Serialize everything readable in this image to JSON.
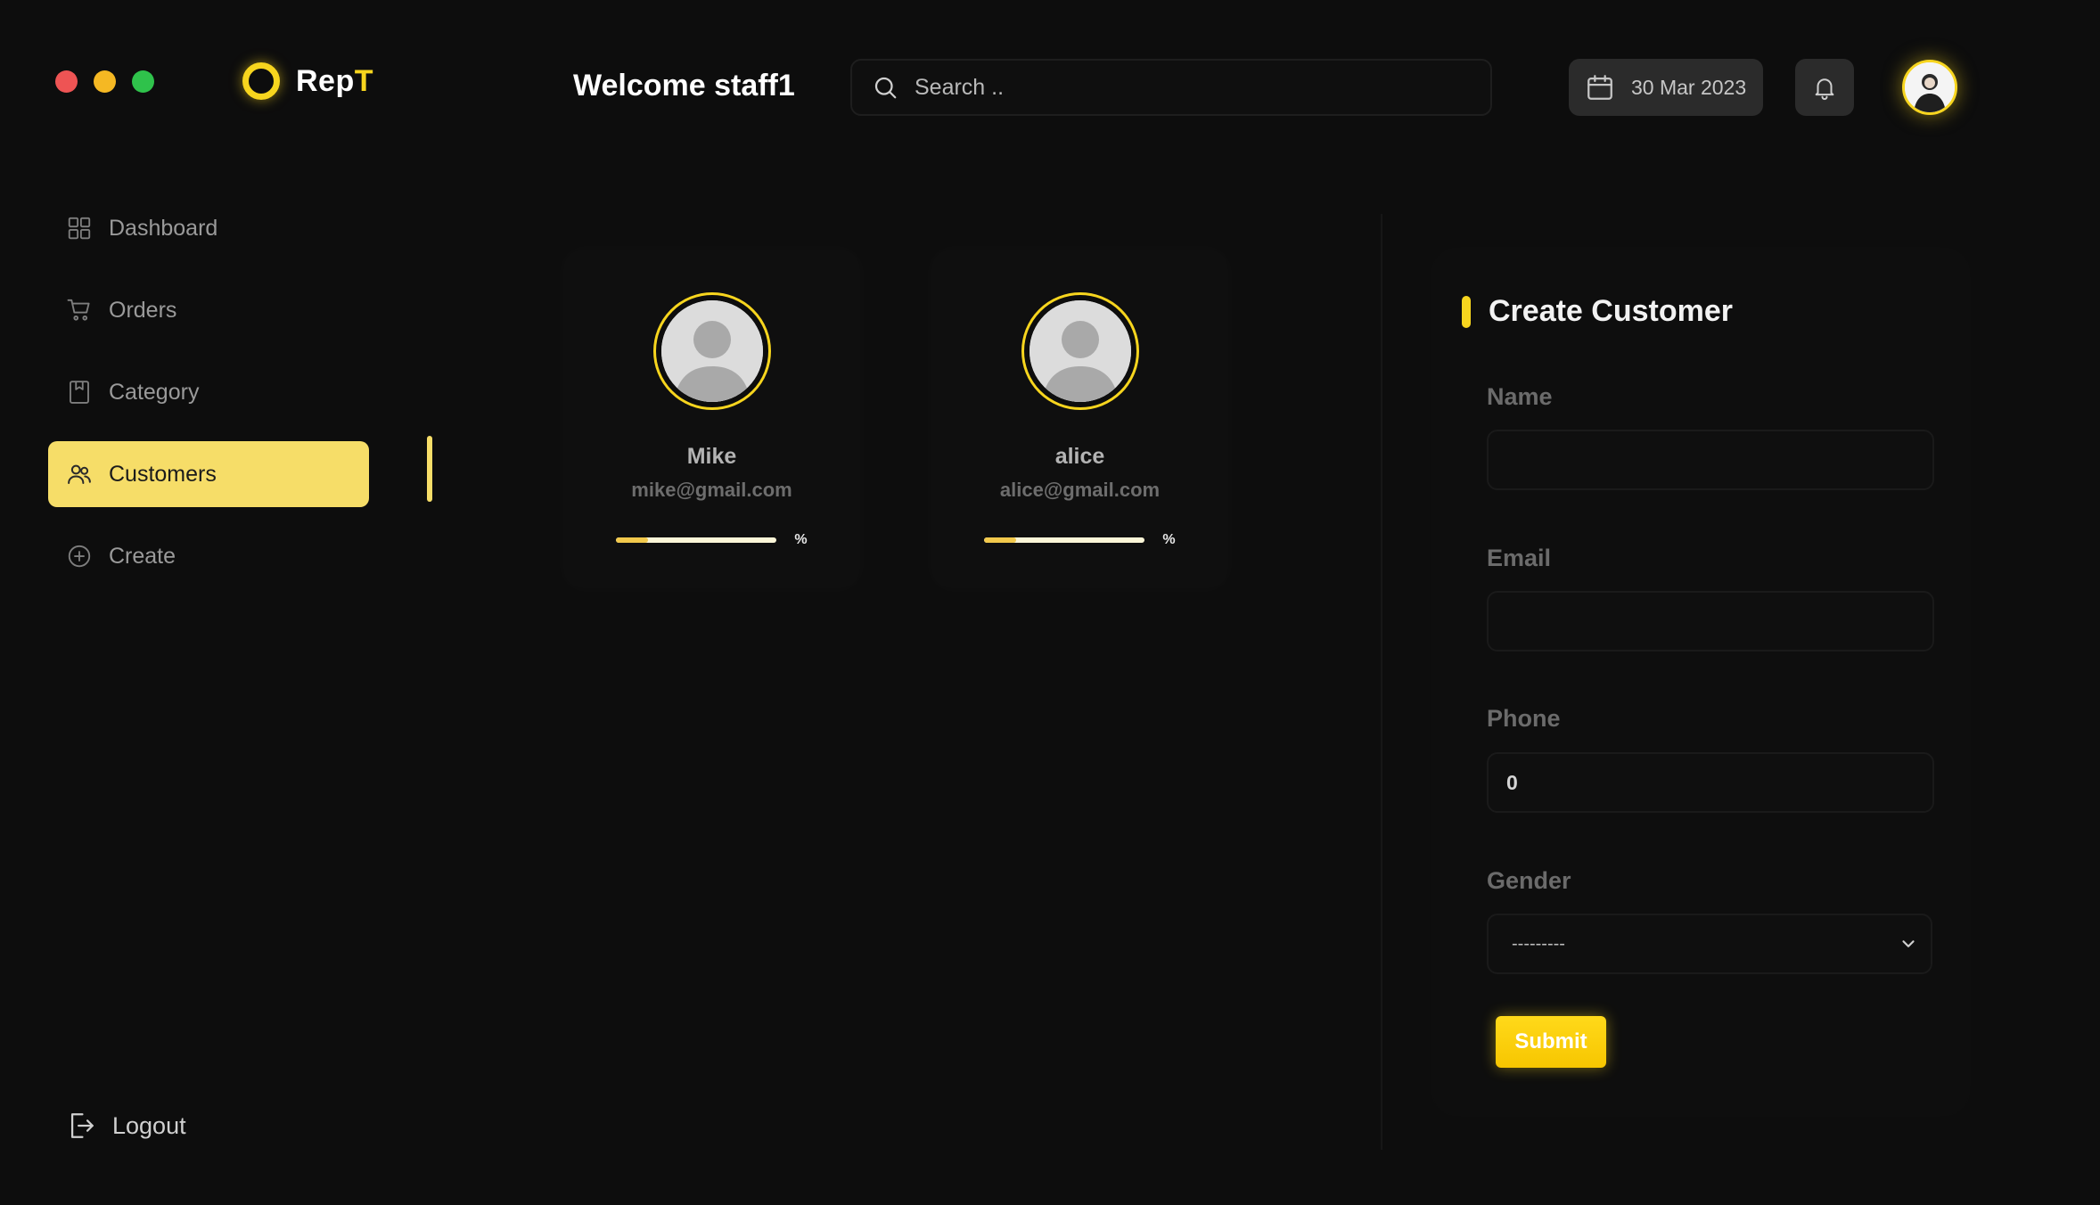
{
  "brand": {
    "name_main": "Rep",
    "name_accent": "T"
  },
  "header": {
    "welcome": "Welcome staff1",
    "search_placeholder": "Search ..",
    "date": "30 Mar 2023"
  },
  "sidebar": {
    "items": [
      {
        "label": "Dashboard",
        "icon": "grid-icon",
        "active": false
      },
      {
        "label": "Orders",
        "icon": "cart-icon",
        "active": false
      },
      {
        "label": "Category",
        "icon": "bookmark-icon",
        "active": false
      },
      {
        "label": "Customers",
        "icon": "users-icon",
        "active": true
      },
      {
        "label": "Create",
        "icon": "plus-circle-icon",
        "active": false
      }
    ],
    "logout_label": "Logout"
  },
  "customers": [
    {
      "name": "Mike",
      "email": "mike@gmail.com",
      "progress": 0.2,
      "progress_suffix": "%"
    },
    {
      "name": "alice",
      "email": "alice@gmail.com",
      "progress": 0.2,
      "progress_suffix": "%"
    }
  ],
  "form": {
    "title": "Create Customer",
    "name_label": "Name",
    "name_value": "",
    "email_label": "Email",
    "email_value": "",
    "phone_label": "Phone",
    "phone_value": "0",
    "gender_label": "Gender",
    "gender_selected": "---------",
    "submit_label": "Submit"
  },
  "colors": {
    "accent": "#f7d51e",
    "active_nav_bg": "#f6dd68",
    "background": "#0d0d0d"
  }
}
